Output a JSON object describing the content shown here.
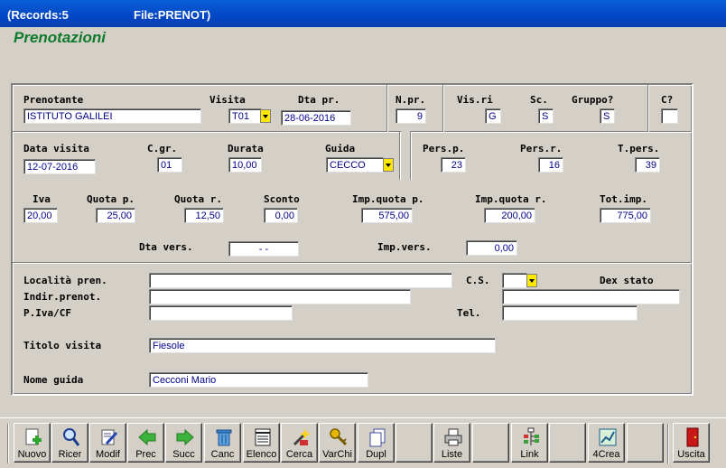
{
  "window": {
    "records": "(Records:5",
    "file": "File:PRENOT)"
  },
  "form_title": "Prenotazioni",
  "section1": {
    "prenotante_label": "Prenotante",
    "prenotante_value": "ISTITUTO GALILEI",
    "visita_label": "Visita",
    "visita_value": "T01",
    "dta_pr_label": "Dta pr.",
    "dta_pr_value": "28-06-2016",
    "npr_label": "N.pr.",
    "npr_value": "9",
    "visri_label": "Vis.ri",
    "visri_value": "G",
    "sc_label": "Sc.",
    "sc_value": "S",
    "gruppo_label": "Gruppo?",
    "gruppo_value": "S",
    "c_label": "C?",
    "c_value": ""
  },
  "section2": {
    "data_visita_label": "Data visita",
    "data_visita_value": "12-07-2016",
    "cgr_label": "C.gr.",
    "cgr_value": "01",
    "durata_label": "Durata",
    "durata_value": "10,00",
    "guida_label": "Guida",
    "guida_value": "CECCO",
    "persp_label": "Pers.p.",
    "persp_value": "23",
    "persr_label": "Pers.r.",
    "persr_value": "16",
    "tpers_label": "T.pers.",
    "tpers_value": "39",
    "iva_label": "Iva",
    "iva_value": "20,00",
    "quotap_label": "Quota p.",
    "quotap_value": "25,00",
    "quotar_label": "Quota r.",
    "quotar_value": "12,50",
    "sconto_label": "Sconto",
    "sconto_value": "0,00",
    "impquotap_label": "Imp.quota p.",
    "impquotap_value": "575,00",
    "impquotar_label": "Imp.quota r.",
    "impquotar_value": "200,00",
    "totimp_label": "Tot.imp.",
    "totimp_value": "775,00",
    "dtavers_label": "Dta vers.",
    "dtavers_value": "  -  -",
    "impvers_label": "Imp.vers.",
    "impvers_value": "0,00"
  },
  "section3": {
    "localita_label": "Località pren.",
    "localita_value": "",
    "cs_label": "C.S.",
    "cs_value": "",
    "dexstato_label": "Dex stato",
    "dexstato_value": "",
    "indir_label": "Indir.prenot.",
    "indir_value": "",
    "piva_label": "P.Iva/CF",
    "piva_value": "",
    "tel_label": "Tel.",
    "tel_value": "",
    "titolo_label": "Titolo visita",
    "titolo_value": "Fiesole",
    "nomeguida_label": "Nome guida",
    "nomeguida_value": "Cecconi Mario"
  },
  "toolbar": {
    "nuovo": "Nuovo",
    "ricer": "Ricer",
    "modif": "Modif",
    "prec": "Prec",
    "succ": "Succ",
    "canc": "Canc",
    "elenco": "Elenco",
    "cerca": "Cerca",
    "varchi": "VarChi",
    "dupl": "Dupl",
    "liste": "Liste",
    "link": "Link",
    "crea4": "4Crea",
    "uscita": "Uscita"
  }
}
